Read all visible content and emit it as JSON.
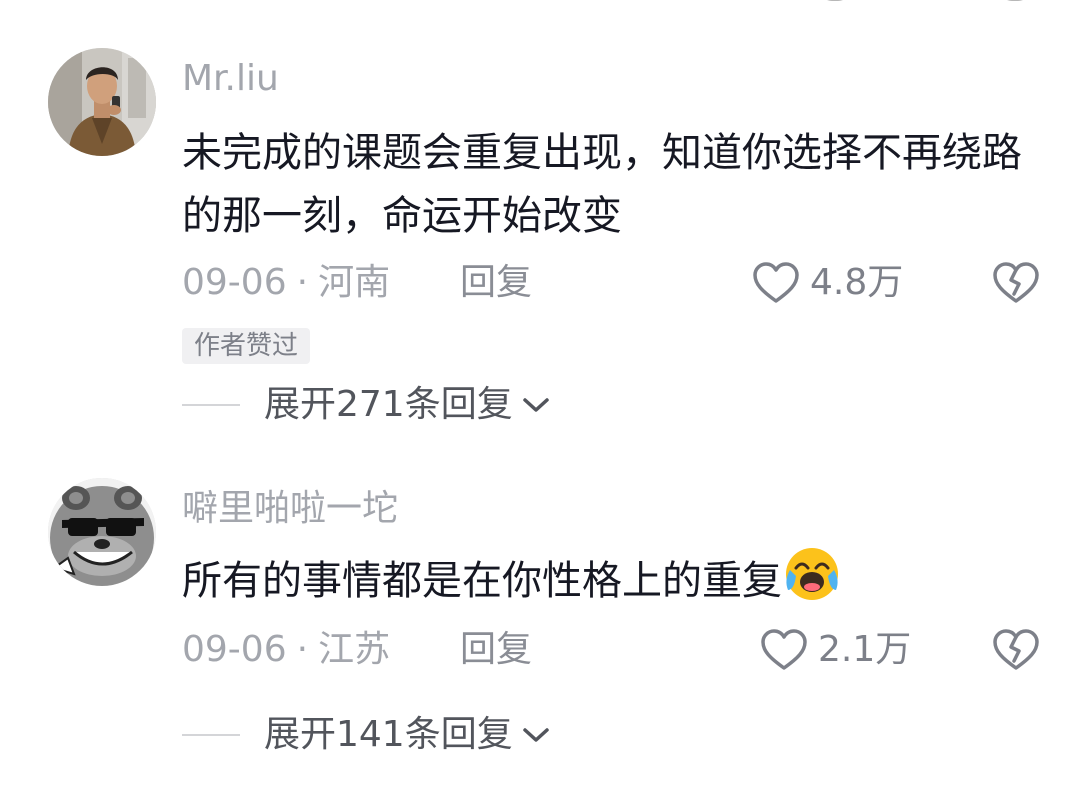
{
  "comments": [
    {
      "username": "Mr.liu",
      "text": "未完成的课题会重复出现，知道你选择不再绕路的那一刻，命运开始改变",
      "date": "09-06",
      "location": "河南",
      "reply_label": "回复",
      "likes": "4.8万",
      "badge": "作者赞过",
      "expand_label": "展开271条回复"
    },
    {
      "username": "噼里啪啦一坨",
      "text": "所有的事情都是在你性格上的重复",
      "emoji": "crying-laughing-emoji",
      "date": "09-06",
      "location": "江苏",
      "reply_label": "回复",
      "likes": "2.1万",
      "expand_label": "展开141条回复"
    }
  ],
  "separator": "·",
  "colors": {
    "text_primary": "#161823",
    "text_secondary": "#a3a6ad",
    "badge_bg": "#f0f0f2",
    "icon": "#7d8089"
  }
}
